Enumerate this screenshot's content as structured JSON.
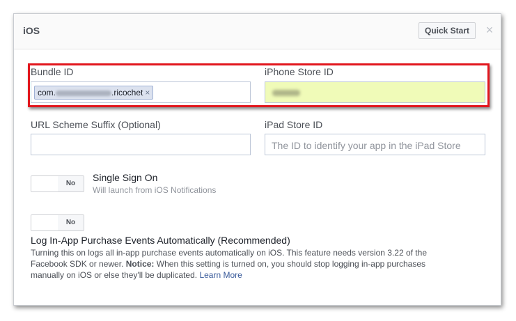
{
  "header": {
    "title": "iOS",
    "quick_start_label": "Quick Start",
    "close_glyph": "×"
  },
  "bundle_id": {
    "label": "Bundle ID",
    "token_prefix": "com.",
    "token_suffix": ".ricochet",
    "token_remove": "×"
  },
  "iphone_store_id": {
    "label": "iPhone Store ID"
  },
  "url_scheme_suffix": {
    "label": "URL Scheme Suffix (Optional)",
    "value": ""
  },
  "ipad_store_id": {
    "label": "iPad Store ID",
    "placeholder": "The ID to identify your app in the iPad Store"
  },
  "single_sign_on": {
    "toggle_state": "No",
    "title": "Single Sign On",
    "subtitle": "Will launch from iOS Notifications"
  },
  "log_iap": {
    "toggle_state": "No",
    "title": "Log In-App Purchase Events Automatically (Recommended)",
    "description_1": "Turning this on logs all in-app purchase events automatically on iOS. This feature needs version 3.22 of the Facebook SDK or newer.",
    "notice_label": "Notice:",
    "description_2": "When this setting is turned on, you should stop logging in-app purchases manually on iOS or else they'll be duplicated.",
    "learn_more": "Learn More"
  },
  "colors": {
    "highlight_outline": "#e2161d",
    "store_id_background": "#f0fbb8",
    "link": "#365899"
  }
}
